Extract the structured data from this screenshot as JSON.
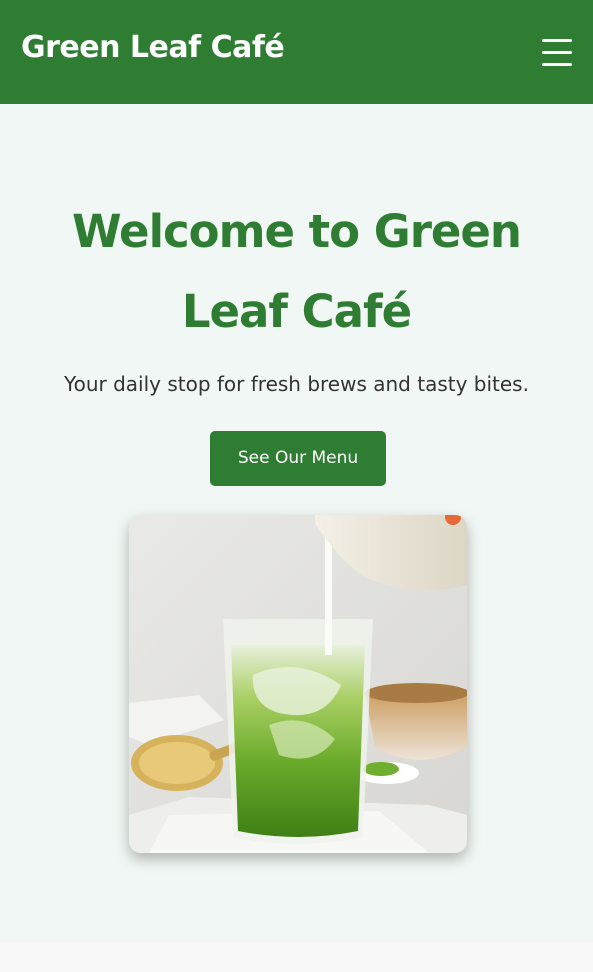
{
  "header": {
    "brand": "Green Leaf Café",
    "menu_icon": "hamburger-menu-icon",
    "background_color": "#2e7d32"
  },
  "hero": {
    "title": "Welcome to Green Leaf Café",
    "subtitle": "Your daily stop for fresh brews and tasty bites.",
    "cta_label": "See Our Menu",
    "image_subject": "iced matcha latte with whisk and matcha powder",
    "accent_color": "#2e7d32",
    "background_color": "#f1f7f4"
  }
}
